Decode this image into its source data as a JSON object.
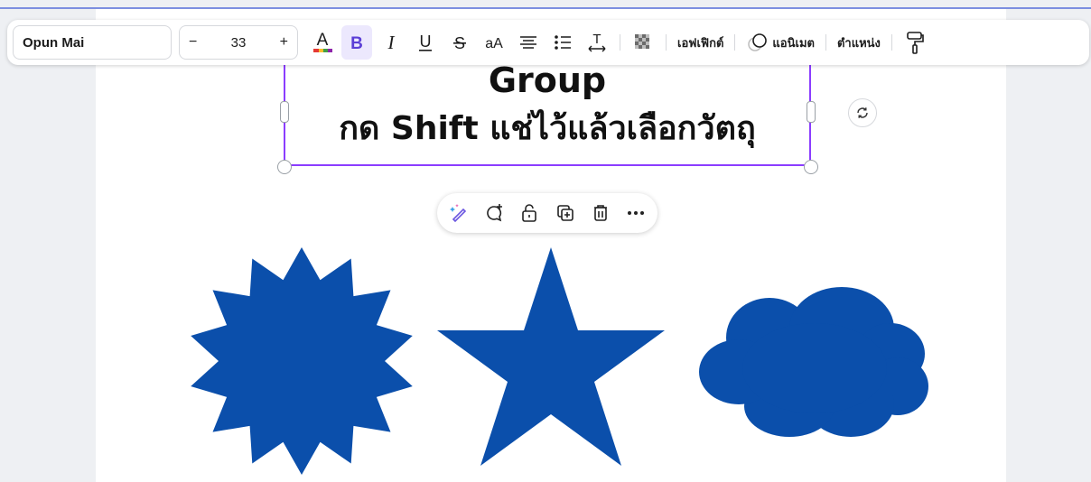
{
  "toolbar": {
    "font_name": "Opun Mai",
    "size_minus": "−",
    "font_size": "33",
    "size_plus": "+",
    "effects_label": "เอฟเฟิกต์",
    "animate_label": "แอนิเมต",
    "position_label": "ตำแหน่ง"
  },
  "text_element": {
    "line1": "Group",
    "line2": "กด Shift แช่ไว้แล้วเลือกวัตถุ"
  },
  "colors": {
    "shape_blue": "#0b4fab",
    "selection_purple": "#8b3dff",
    "bold_active_bg": "#ece8fd"
  },
  "icons": {
    "font_color": "text-color-icon",
    "bold": "bold-icon",
    "italic": "italic-icon",
    "underline": "underline-icon",
    "strike": "strikethrough-icon",
    "case": "letter-case-icon",
    "align": "align-center-icon",
    "list": "bullet-list-icon",
    "spacing": "text-spacing-icon",
    "transparency": "transparency-icon",
    "paint": "paint-roller-icon",
    "rotate": "rotate-icon",
    "magic": "magic-edit-icon",
    "comment": "add-comment-icon",
    "lock": "lock-icon",
    "duplicate": "duplicate-icon",
    "trash": "trash-icon",
    "more": "more-icon"
  },
  "shapes": [
    "starburst",
    "star",
    "cloud"
  ]
}
